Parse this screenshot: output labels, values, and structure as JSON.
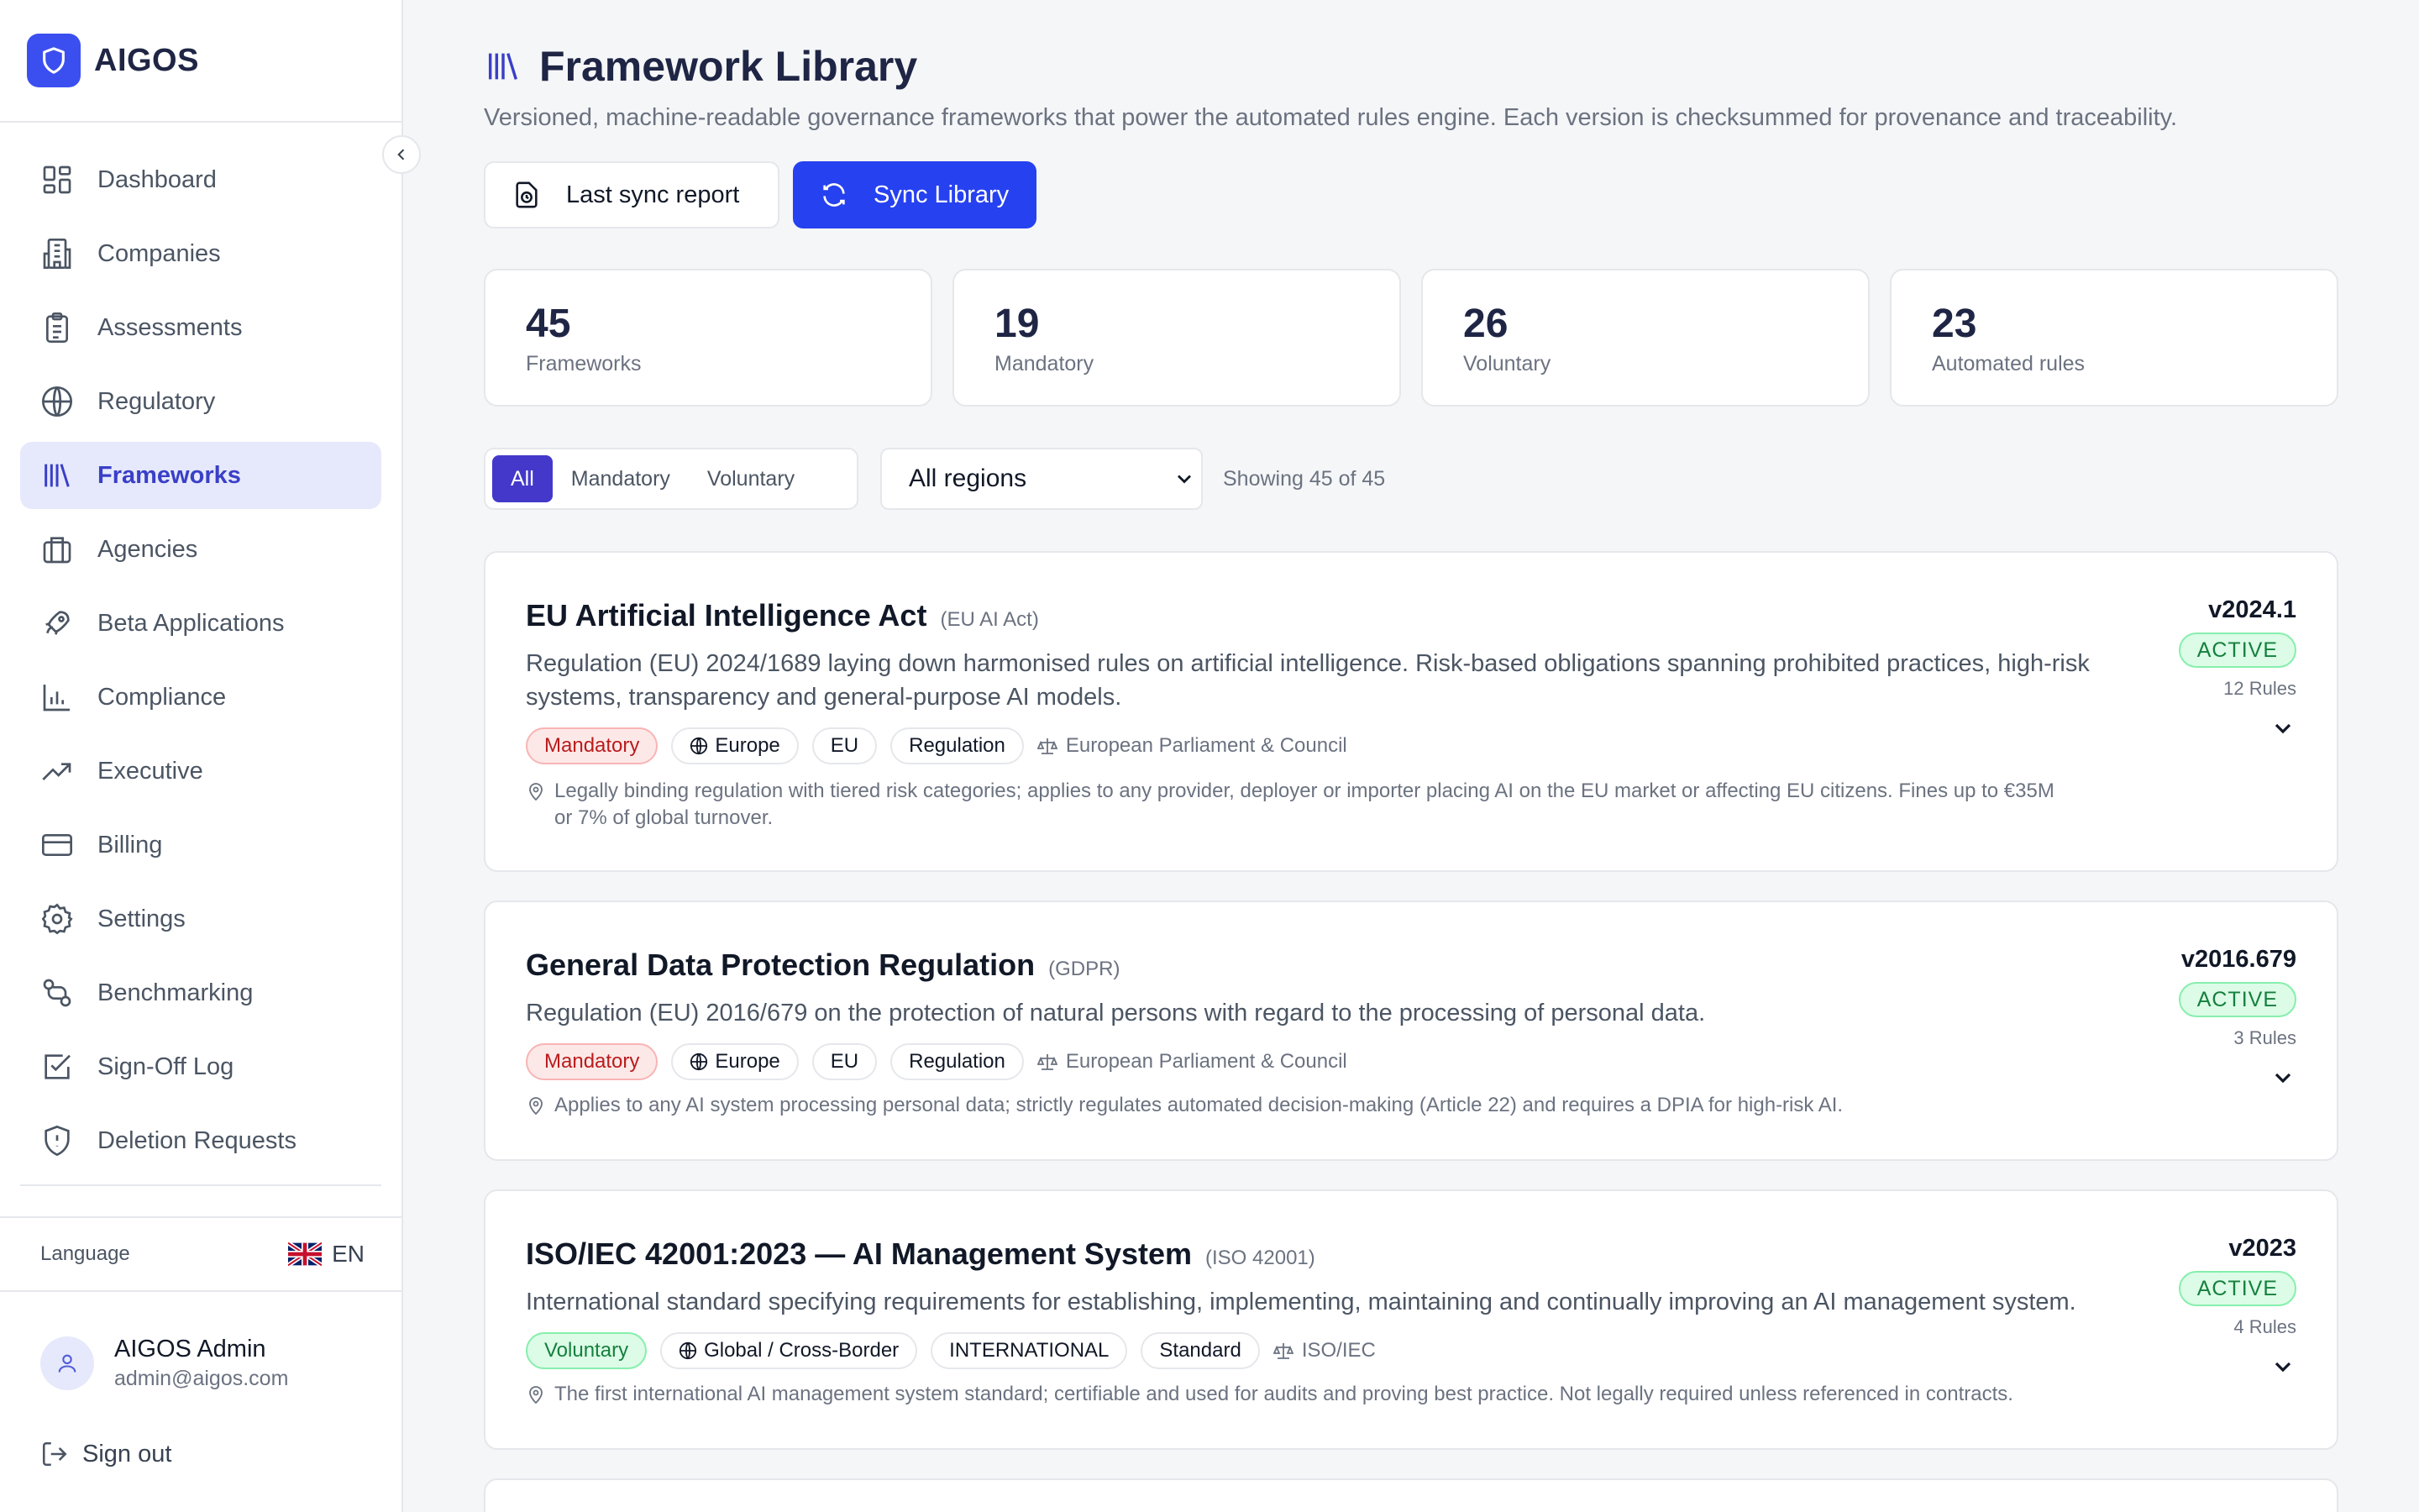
{
  "brand": {
    "name": "AIGOS"
  },
  "sidebar": {
    "items": [
      {
        "label": "Dashboard",
        "icon": "dashboard-icon"
      },
      {
        "label": "Companies",
        "icon": "building-icon"
      },
      {
        "label": "Assessments",
        "icon": "clipboard-icon"
      },
      {
        "label": "Regulatory",
        "icon": "globe-icon"
      },
      {
        "label": "Frameworks",
        "icon": "library-icon",
        "active": true
      },
      {
        "label": "Agencies",
        "icon": "briefcase-icon"
      },
      {
        "label": "Beta Applications",
        "icon": "rocket-icon"
      },
      {
        "label": "Compliance",
        "icon": "bar-chart-icon"
      },
      {
        "label": "Executive",
        "icon": "trending-up-icon"
      },
      {
        "label": "Billing",
        "icon": "credit-card-icon"
      },
      {
        "label": "Settings",
        "icon": "gear-icon"
      },
      {
        "label": "Benchmarking",
        "icon": "git-compare-icon"
      },
      {
        "label": "Sign-Off Log",
        "icon": "check-square-icon"
      },
      {
        "label": "Deletion Requests",
        "icon": "shield-icon"
      }
    ],
    "language_label": "Language",
    "language_value": "EN",
    "user": {
      "name": "AIGOS Admin",
      "email": "admin@aigos.com"
    },
    "signout_label": "Sign out"
  },
  "page": {
    "title": "Framework Library",
    "subtitle": "Versioned, machine-readable governance frameworks that power the automated rules engine. Each version is checksummed for provenance and traceability.",
    "last_sync_label": "Last sync report",
    "sync_label": "Sync Library"
  },
  "stats": [
    {
      "value": "45",
      "label": "Frameworks"
    },
    {
      "value": "19",
      "label": "Mandatory"
    },
    {
      "value": "26",
      "label": "Voluntary"
    },
    {
      "value": "23",
      "label": "Automated rules"
    }
  ],
  "filters": {
    "tabs": [
      "All",
      "Mandatory",
      "Voluntary"
    ],
    "active_tab": "All",
    "region_selected": "All regions",
    "showing": "Showing 45 of 45"
  },
  "frameworks": [
    {
      "title": "EU Artificial Intelligence Act",
      "abbr": "(EU AI Act)",
      "desc_line1": "Regulation (EU) 2024/1689 laying down harmonised rules on artificial intelligence. Risk-based obligations spanning prohibited practices, high-risk",
      "desc_line2": "systems, transparency and general-purpose AI models.",
      "type": "Mandatory",
      "region": "Europe",
      "jurisdiction": "EU",
      "kind": "Regulation",
      "authority": "European Parliament & Council",
      "note_line1": "Legally binding regulation with tiered risk categories; applies to any provider, deployer or importer placing AI on the EU market or affecting EU citizens. Fines up to €35M",
      "note_line2": "or 7% of global turnover.",
      "version": "v2024.1",
      "status": "ACTIVE",
      "rules": "12 Rules"
    },
    {
      "title": "General Data Protection Regulation",
      "abbr": "(GDPR)",
      "desc_line1": "Regulation (EU) 2016/679 on the protection of natural persons with regard to the processing of personal data.",
      "type": "Mandatory",
      "region": "Europe",
      "jurisdiction": "EU",
      "kind": "Regulation",
      "authority": "European Parliament & Council",
      "note_line1": "Applies to any AI system processing personal data; strictly regulates automated decision-making (Article 22) and requires a DPIA for high-risk AI.",
      "version": "v2016.679",
      "status": "ACTIVE",
      "rules": "3 Rules"
    },
    {
      "title": "ISO/IEC 42001:2023 — AI Management System",
      "abbr": "(ISO 42001)",
      "desc_line1": "International standard specifying requirements for establishing, implementing, maintaining and continually improving an AI management system.",
      "type": "Voluntary",
      "region": "Global / Cross-Border",
      "jurisdiction": "INTERNATIONAL",
      "kind": "Standard",
      "authority": "ISO/IEC",
      "note_line1": "The first international AI management system standard; certifiable and used for audits and proving best practice. Not legally required unless referenced in contracts.",
      "version": "v2023",
      "status": "ACTIVE",
      "rules": "4 Rules"
    }
  ],
  "colors": {
    "accent": "#2641f0",
    "active_nav_bg": "#e6e9fb",
    "mandatory": "#b91c1c",
    "voluntary": "#15803d"
  }
}
